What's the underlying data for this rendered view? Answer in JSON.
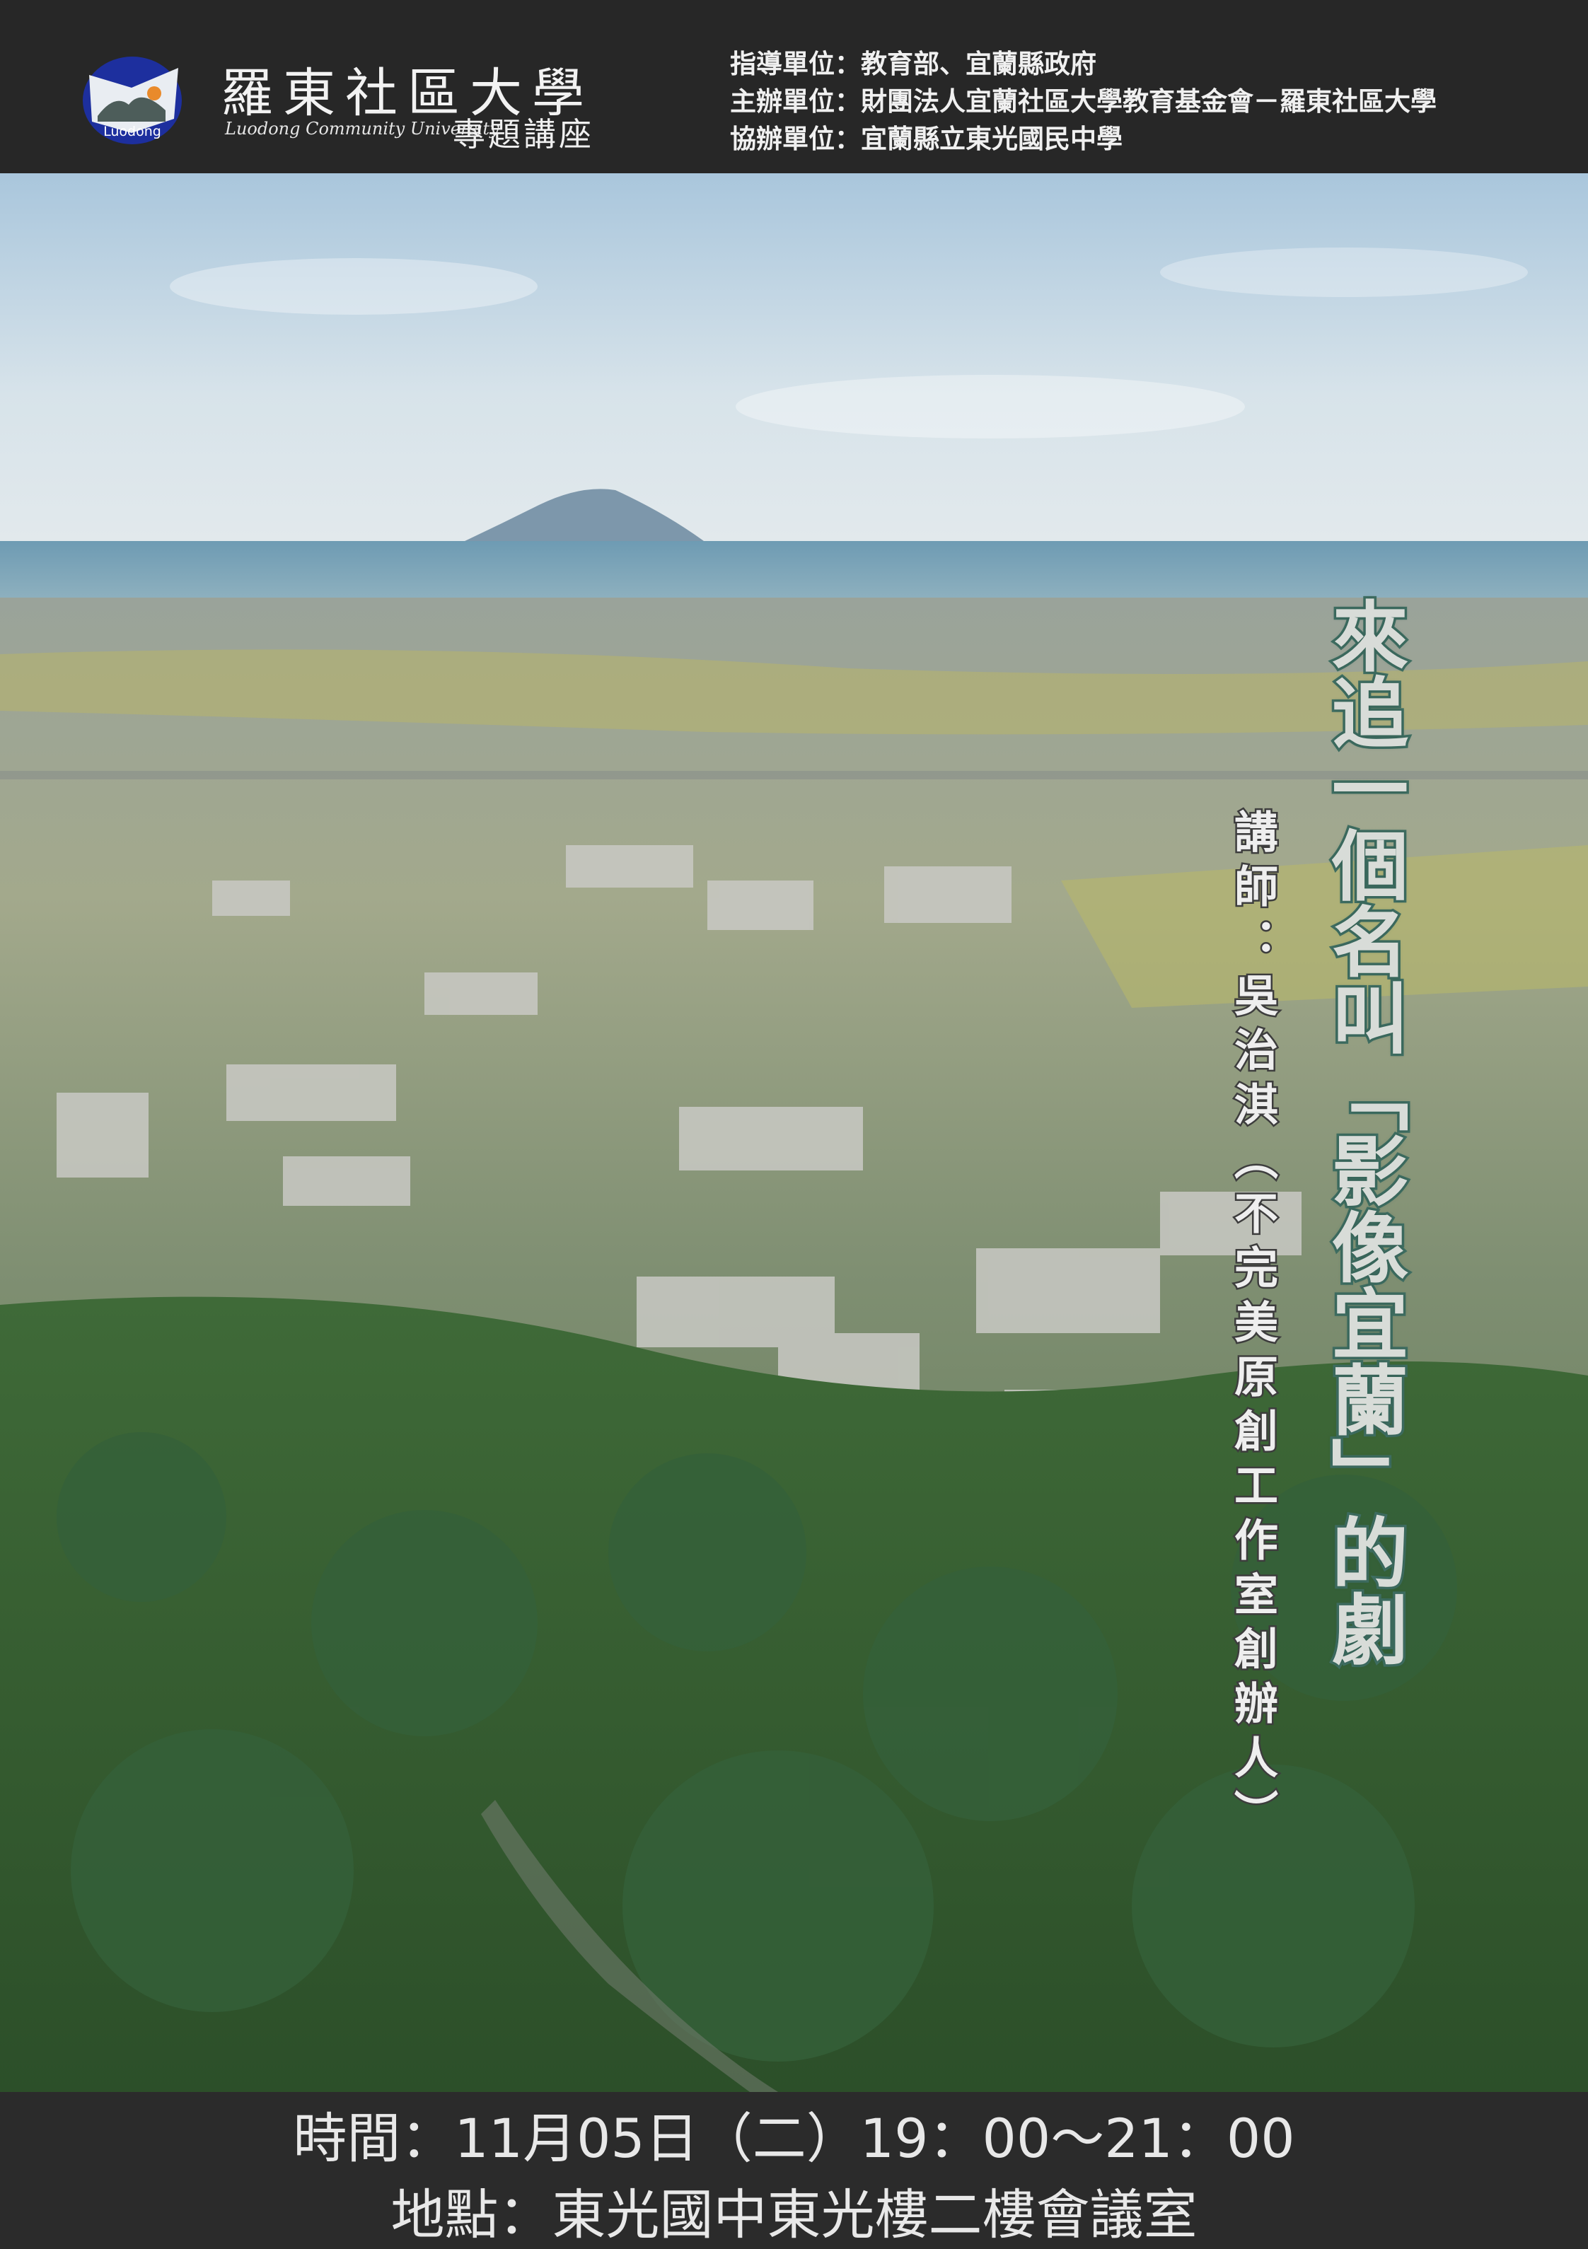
{
  "header": {
    "logo_text": "Luodong",
    "university_name": "羅東社區大學",
    "university_name_en": "Luodong Community University",
    "series_name": "專題講座",
    "organizers": [
      "指導單位：教育部、宜蘭縣政府",
      "主辦單位：財團法人宜蘭社區大學教育基金會－羅東社區大學",
      "協辦單位：宜蘭縣立東光國民中學"
    ]
  },
  "main": {
    "title": "來追一個名叫「影像宜蘭」的劇",
    "speaker": "講師：吳治淇（不完美原創工作室創辦人）"
  },
  "footer": {
    "time": "時間：11月05日（二）19：00～21：00",
    "location": "地點：東光國中東光樓二樓會議室"
  },
  "colors": {
    "header_bg": "#272727",
    "title_fill": "#d8dcd8",
    "title_stroke": "#3f6e62",
    "logo_blue": "#1d2f9e",
    "logo_orange": "#e98a2b"
  },
  "icons": {
    "logo": "luodong-university-logo"
  }
}
